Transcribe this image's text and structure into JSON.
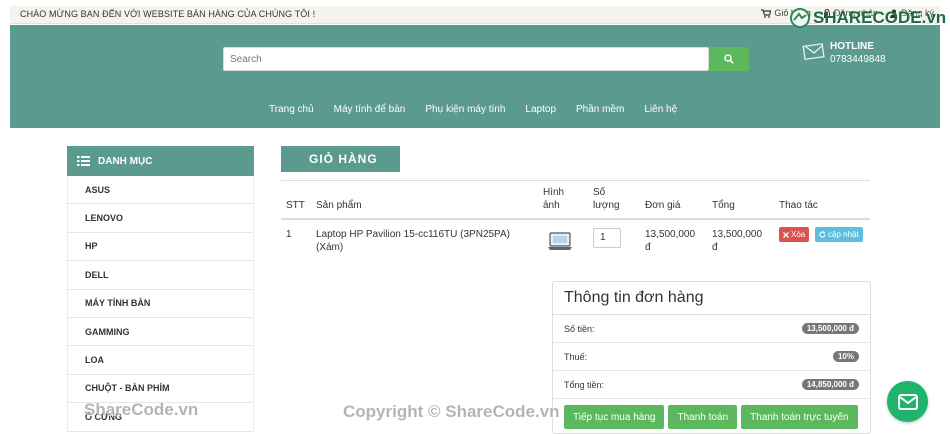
{
  "topbar": {
    "welcome": "CHÀO MỪNG BẠN ĐẾN VỚI WEBSITE BÁN HÀNG CỦA CHÚNG TÔI !",
    "cart": "Giỏ hàng",
    "login": "Đăng nhập",
    "register": "Đăng ký"
  },
  "logo": {
    "text": "SHARECODE.vn"
  },
  "header": {
    "search_placeholder": "Search",
    "hotline_label": "HOTLINE",
    "hotline_number": "0783449848",
    "accent_color": "#5b9a8e"
  },
  "nav": [
    "Trang chủ",
    "Máy tính để bàn",
    "Phụ kiện máy tính",
    "Laptop",
    "Phần mềm",
    "Liên hệ"
  ],
  "sidebar": {
    "title": "DANH MỤC",
    "items": [
      "ASUS",
      "LENOVO",
      "HP",
      "DELL",
      "MÁY TÍNH BÀN",
      "GAMMING",
      "LOA",
      "CHUỘT - BÀN PHÍM",
      "Ổ CỨNG"
    ]
  },
  "cart": {
    "banner": "GIỎ HÀNG",
    "headers": {
      "stt": "STT",
      "product": "Sản phẩm",
      "image_1": "Hình",
      "image_2": "ảnh",
      "qty_1": "Số",
      "qty_2": "lượng",
      "unit_price": "Đơn giá",
      "total": "Tổng",
      "actions": "Thao tác"
    },
    "rows": [
      {
        "stt": "1",
        "product_1": "Laptop HP Pavilion 15-cc116TU (3PN25PA)",
        "product_2": "(Xám)",
        "qty": "1",
        "price_1": "13,500,000",
        "price_2": "đ",
        "total_1": "13,500,000",
        "total_2": "đ",
        "delete_label": "Xóa",
        "update_label": "cập nhật"
      }
    ]
  },
  "order": {
    "title": "Thông tin đơn hàng",
    "subtotal_label": "Số tiền:",
    "subtotal_value": "13,500,000 đ",
    "tax_label": "Thuế:",
    "tax_value": "10%",
    "grand_label": "Tổng tiền:",
    "grand_value": "14,850,000 đ",
    "btn_continue": "Tiếp tục mua hàng",
    "btn_checkout": "Thanh toán",
    "btn_online": "Thanh toán trực tuyến"
  },
  "watermarks": [
    "ShareCode.vn",
    "Copyright © ShareCode.vn"
  ]
}
